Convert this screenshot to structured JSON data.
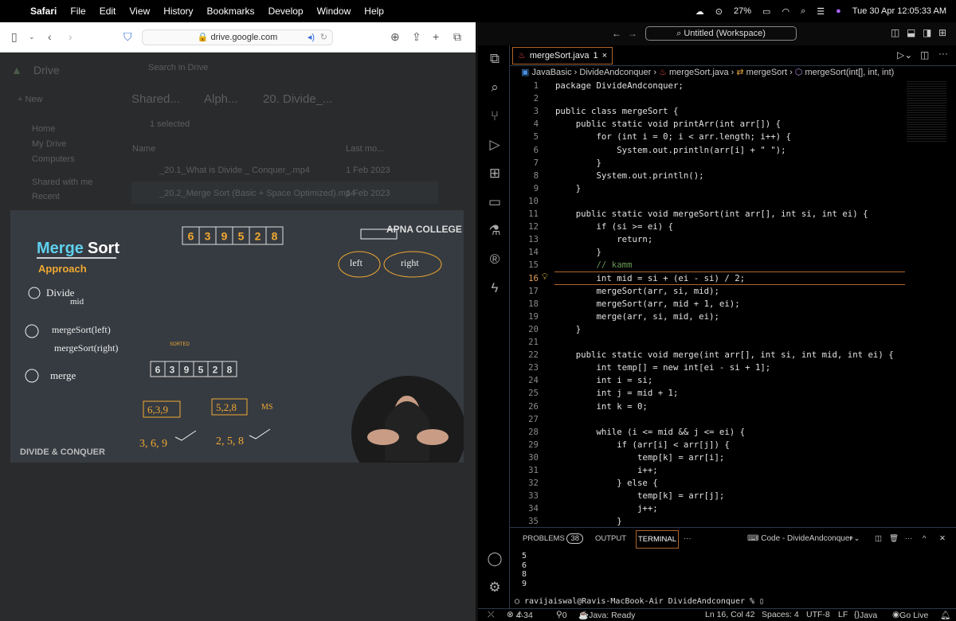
{
  "menubar": {
    "app": "Safari",
    "items": [
      "File",
      "Edit",
      "View",
      "History",
      "Bookmarks",
      "Develop",
      "Window",
      "Help"
    ],
    "battery": "27%",
    "datetime": "Tue 30 Apr  12:05:33 AM"
  },
  "safari": {
    "url": "drive.google.com"
  },
  "drive": {
    "logo": "Drive",
    "search_placeholder": "Search in Drive",
    "new_label": "New",
    "breadcrumb": [
      "Shared...",
      "Alph...",
      "20. Divide_..."
    ],
    "selected": "1 selected",
    "nav": [
      "Home",
      "My Drive",
      "Computers",
      "Shared with me",
      "Recent"
    ],
    "col_name": "Name",
    "col_modified": "Last mo...",
    "files": [
      {
        "name": "_20.1_What is Divide _ Conquer_.mp4",
        "date": "1 Feb 2023"
      },
      {
        "name": "_20.2_Merge Sort (Basic + Space Optimized).mp4",
        "date": "1 Feb 2023"
      }
    ]
  },
  "video": {
    "title_a": "Merge",
    "title_b": "Sort",
    "subtitle": "Approach",
    "brand": "APNA COLLEGE",
    "footer": "DIVIDE & CONQUER",
    "array": [
      "6",
      "3",
      "9",
      "5",
      "2",
      "8"
    ],
    "steps": [
      "Divide",
      "mid",
      "mergeSort(left)",
      "mergeSort(right)",
      "merge"
    ],
    "results": [
      "3, 6, 9",
      "2, 5, 8"
    ],
    "groups": [
      "6,3,9",
      "5,2,8"
    ],
    "labels": [
      "left",
      "right"
    ],
    "ms": "MS",
    "sorted": "SORTED",
    "accent": "#f0a832"
  },
  "vscode": {
    "workspace": "Untitled (Workspace)",
    "tab": {
      "name": "mergeSort.java",
      "badge": "1"
    },
    "breadcrumb": [
      "JavaBasic",
      "DivideAndconquer",
      "mergeSort.java",
      "mergeSort",
      "mergeSort(int[], int, int)"
    ],
    "current_line": 16,
    "code": [
      "package DivideAndconquer;",
      "",
      "public class mergeSort {",
      "    public static void printArr(int arr[]) {",
      "        for (int i = 0; i < arr.length; i++) {",
      "            System.out.println(arr[i] + \" \");",
      "        }",
      "        System.out.println();",
      "    }",
      "",
      "    public static void mergeSort(int arr[], int si, int ei) {",
      "        if (si >= ei) {",
      "            return;",
      "        }",
      "        // kamm",
      "        int mid = si + (ei - si) / 2;",
      "        mergeSort(arr, si, mid);",
      "        mergeSort(arr, mid + 1, ei);",
      "        merge(arr, si, mid, ei);",
      "    }",
      "",
      "    public static void merge(int arr[], int si, int mid, int ei) {",
      "        int temp[] = new int[ei - si + 1];",
      "        int i = si;",
      "        int j = mid + 1;",
      "        int k = 0;",
      "",
      "        while (i <= mid && j <= ei) {",
      "            if (arr[i] < arr[j]) {",
      "                temp[k] = arr[i];",
      "                i++;",
      "            } else {",
      "                temp[k] = arr[j];",
      "                j++;",
      "            }"
    ],
    "panel": {
      "problems": "PROBLEMS",
      "problems_count": "38",
      "output": "OUTPUT",
      "terminal": "TERMINAL",
      "terminal_name": "Code - DivideAndconquer",
      "output_lines": "5\n6\n8\n9",
      "prompt": "○ ravijaiswal@Ravis-MacBook-Air DivideAndconquer % ▯"
    },
    "status": {
      "errors": "4",
      "warnings": "34",
      "ports": "0",
      "java": "Java: Ready",
      "position": "Ln 16, Col 42",
      "spaces": "Spaces: 4",
      "encoding": "UTF-8",
      "eol": "LF",
      "language": "Java",
      "golive": "Go Live"
    }
  }
}
